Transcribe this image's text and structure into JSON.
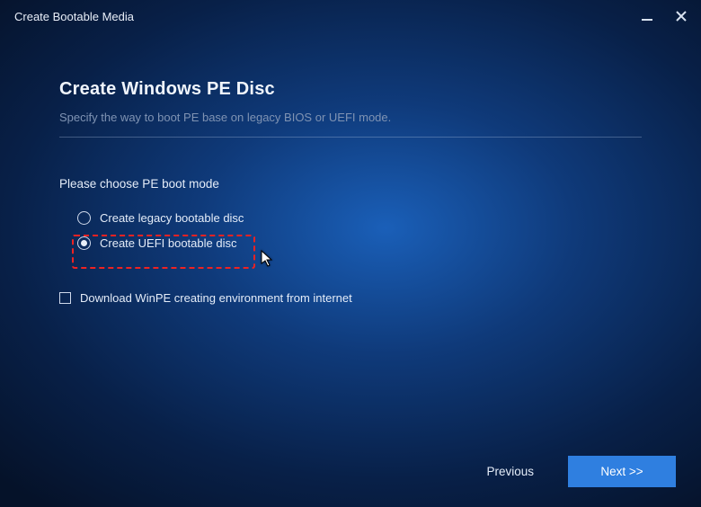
{
  "window": {
    "title": "Create Bootable Media"
  },
  "page": {
    "heading": "Create Windows PE Disc",
    "subheading": "Specify the way to boot PE base on legacy BIOS or UEFI mode."
  },
  "boot_mode": {
    "label": "Please choose PE boot mode",
    "options": [
      {
        "label": "Create legacy bootable disc",
        "checked": false
      },
      {
        "label": "Create UEFI bootable disc",
        "checked": true
      }
    ]
  },
  "download": {
    "label": "Download WinPE creating environment from internet",
    "checked": false
  },
  "footer": {
    "previous": "Previous",
    "next": "Next >>"
  }
}
